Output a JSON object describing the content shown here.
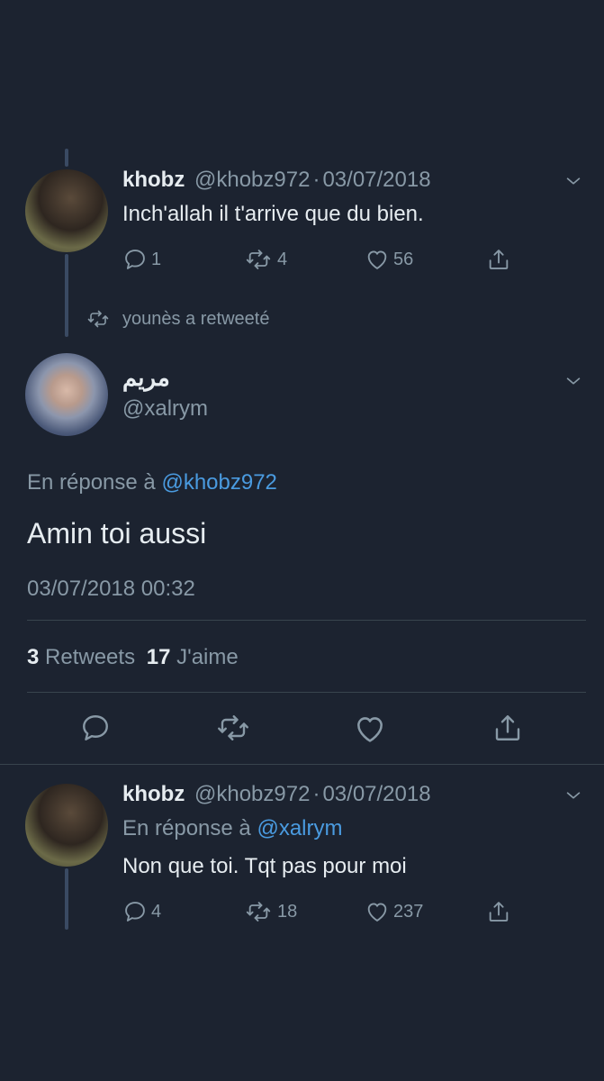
{
  "tweet1": {
    "name": "khobz",
    "handle": "@khobz972",
    "separator": "·",
    "date": "03/07/2018",
    "text": "Inch'allah il t'arrive que du bien.",
    "replies": "1",
    "retweets": "4",
    "likes": "56"
  },
  "retweet_notice": "younès a retweeté",
  "main_tweet": {
    "name": "مريم",
    "handle": "@xalrym",
    "reply_prefix": "En réponse à",
    "reply_to": "@khobz972",
    "text": "Amin toi aussi",
    "timestamp": "03/07/2018 00:32",
    "retweet_count": "3",
    "retweet_label": "Retweets",
    "like_count": "17",
    "like_label": "J'aime"
  },
  "tweet3": {
    "name": "khobz",
    "handle": "@khobz972",
    "separator": "·",
    "date": "03/07/2018",
    "reply_prefix": "En réponse à",
    "reply_to": "@xalrym",
    "text": "Non que toi. Tqt pas pour moi",
    "replies": "4",
    "retweets": "18",
    "likes": "237"
  },
  "icons": {
    "reply": "reply-icon",
    "retweet": "retweet-icon",
    "like": "heart-icon",
    "share": "share-icon",
    "more": "chevron-down-icon"
  },
  "colors": {
    "background": "#1c2330",
    "text": "#e6ecf0",
    "muted": "#8899a6",
    "link": "#4a9be0",
    "thread_line": "#3a4a63"
  }
}
